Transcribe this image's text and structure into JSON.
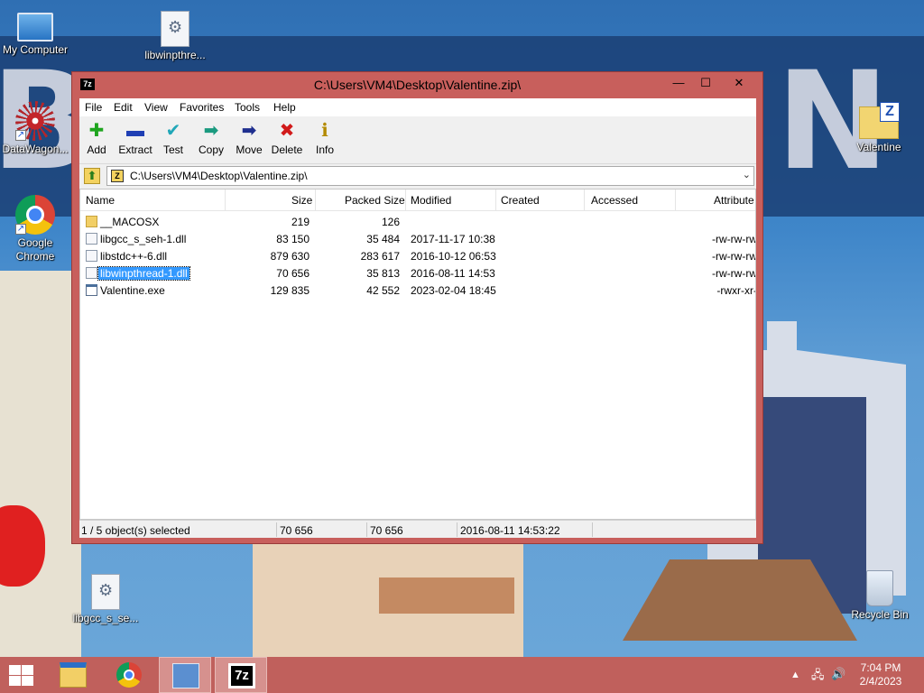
{
  "desktop": {
    "icons": [
      {
        "label": "My Computer",
        "icon": "computer-icon"
      },
      {
        "label": "libwinpthre...",
        "icon": "dll-file-icon"
      },
      {
        "label": "DataWagon...",
        "icon": "datawagon-icon"
      },
      {
        "label": "Google Chrome",
        "icon": "chrome-icon"
      },
      {
        "label": "Valentine",
        "icon": "7zip-archive-folder-icon"
      },
      {
        "label": "libgcc_s_se...",
        "icon": "dll-file-icon"
      },
      {
        "label": "Recycle Bin",
        "icon": "recycle-bin-icon"
      }
    ]
  },
  "window": {
    "logo": "7z",
    "title": "C:\\Users\\VM4\\Desktop\\Valentine.zip\\",
    "controls": {
      "minimize": "—",
      "maximize": "☐",
      "close": "✕"
    }
  },
  "menu": [
    "File",
    "Edit",
    "View",
    "Favorites",
    "Tools",
    "Help"
  ],
  "toolbar": [
    {
      "label": "Add",
      "icon": "plus-icon",
      "glyph": "✚",
      "color": "#1fa51f"
    },
    {
      "label": "Extract",
      "icon": "minus-icon",
      "glyph": "▬",
      "color": "#1f3fb4"
    },
    {
      "label": "Test",
      "icon": "check-icon",
      "glyph": "✔",
      "color": "#21a7b8"
    },
    {
      "label": "Copy",
      "icon": "copy-arrow-icon",
      "glyph": "➡",
      "color": "#1a9a7f"
    },
    {
      "label": "Move",
      "icon": "move-arrow-icon",
      "glyph": "➡",
      "color": "#1f2f8f"
    },
    {
      "label": "Delete",
      "icon": "delete-x-icon",
      "glyph": "✖",
      "color": "#d11a1a"
    },
    {
      "label": "Info",
      "icon": "info-icon",
      "glyph": "ℹ",
      "color": "#b38a00"
    }
  ],
  "address": {
    "path": "C:\\Users\\VM4\\Desktop\\Valentine.zip\\"
  },
  "columns": {
    "name": "Name",
    "size": "Size",
    "packed": "Packed Size",
    "modified": "Modified",
    "created": "Created",
    "accessed": "Accessed",
    "attributes": "Attribute"
  },
  "files": [
    {
      "name": "__MACOSX",
      "type": "folder",
      "size": "219",
      "packed": "126",
      "modified": "",
      "attributes": ""
    },
    {
      "name": "libgcc_s_seh-1.dll",
      "type": "dll",
      "size": "83 150",
      "packed": "35 484",
      "modified": "2017-11-17 10:38",
      "attributes": "-rw-rw-rw"
    },
    {
      "name": "libstdc++-6.dll",
      "type": "dll",
      "size": "879 630",
      "packed": "283 617",
      "modified": "2016-10-12 06:53",
      "attributes": "-rw-rw-rw"
    },
    {
      "name": "libwinpthread-1.dll",
      "type": "dll",
      "size": "70 656",
      "packed": "35 813",
      "modified": "2016-08-11 14:53",
      "attributes": "-rw-rw-rw",
      "selected": true
    },
    {
      "name": "Valentine.exe",
      "type": "exe",
      "size": "129 835",
      "packed": "42 552",
      "modified": "2023-02-04 18:45",
      "attributes": "-rwxr-xr-"
    }
  ],
  "status": {
    "selection": "1 / 5 object(s) selected",
    "size": "70 656",
    "packed": "70 656",
    "modified": "2016-08-11 14:53:22"
  },
  "taskbar": {
    "apps": [
      {
        "name": "File Explorer",
        "icon": "file-explorer-icon"
      },
      {
        "name": "Google Chrome",
        "icon": "chrome-icon"
      },
      {
        "name": "Control Panel",
        "icon": "control-panel-icon"
      },
      {
        "name": "7-Zip File Manager",
        "icon": "7zip-icon",
        "glyph": "7z"
      }
    ],
    "time": "7:04 PM",
    "date": "2/4/2023"
  },
  "colors": {
    "window_frame": "#c85f5c",
    "taskbar": "#c0605c",
    "selection": "#3399ff"
  }
}
